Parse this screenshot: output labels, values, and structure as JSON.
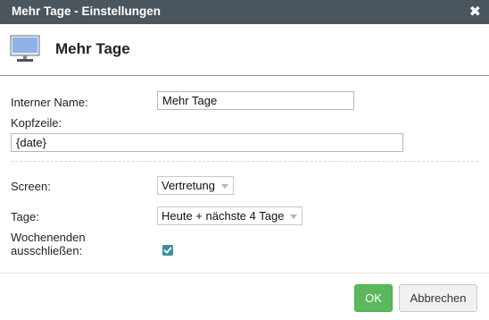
{
  "dialog": {
    "title": "Mehr Tage - Einstellungen",
    "close_label": "✖"
  },
  "header": {
    "title": "Mehr Tage",
    "icon": "monitor-icon"
  },
  "form": {
    "internal_name": {
      "label": "Interner Name:",
      "value": "Mehr Tage"
    },
    "header_line": {
      "label": "Kopfzeile:",
      "value": "{date}"
    },
    "screen": {
      "label": "Screen:",
      "selected": "Vertretung"
    },
    "days": {
      "label": "Tage:",
      "selected": "Heute + nächste 4 Tage"
    },
    "exclude_weekends": {
      "label_line1": "Wochenenden",
      "label_line2": "ausschließen:",
      "checked": true
    }
  },
  "buttons": {
    "ok": "OK",
    "cancel": "Abbrechen"
  },
  "colors": {
    "titlebar": "#4b555d",
    "ok_button": "#5cb85c",
    "checkbox": "#3e8f9e",
    "monitor_screen": "#8fb2e6"
  }
}
